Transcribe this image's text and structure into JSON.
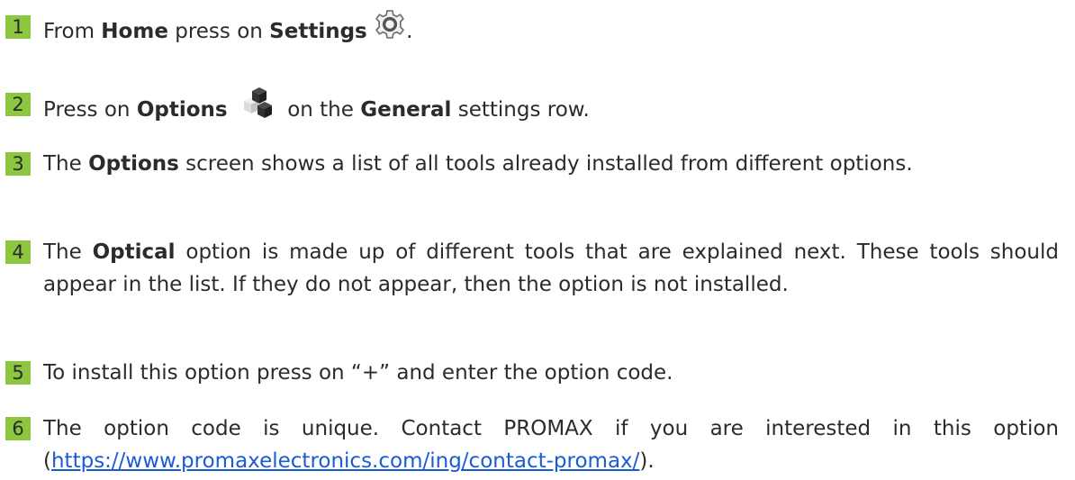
{
  "steps": [
    {
      "number": "1",
      "t1": "From ",
      "b1": "Home",
      "t2": " press on ",
      "b2": "Settings",
      "icon": "gear-icon",
      "t3": "."
    },
    {
      "number": "2",
      "t1": "Press on ",
      "b1": "Options",
      "icon": "cubes-icon",
      "t2": " on the ",
      "b2": "General",
      "t3": " settings row."
    },
    {
      "number": "3",
      "t1": "The ",
      "b1": "Options",
      "t2": " screen shows a list of all tools already installed from different options."
    },
    {
      "number": "4",
      "t1": "The ",
      "b1": "Optical",
      "t2": " option is made up of different tools that are explained next. These tools should appear in the list. If they do not appear, then the option is not installed."
    },
    {
      "number": "5",
      "t1": "To install this option press on “+” and enter the option code."
    },
    {
      "number": "6",
      "t1": "The option code is unique. Contact PROMAX if you are interested in this option (",
      "link": "https://www.promaxelectronics.com/ing/contact-promax/",
      "t2": ")."
    }
  ],
  "colors": {
    "step_badge": "#8dc63f",
    "link": "#1a5bd6",
    "text": "#2b2b2b"
  }
}
